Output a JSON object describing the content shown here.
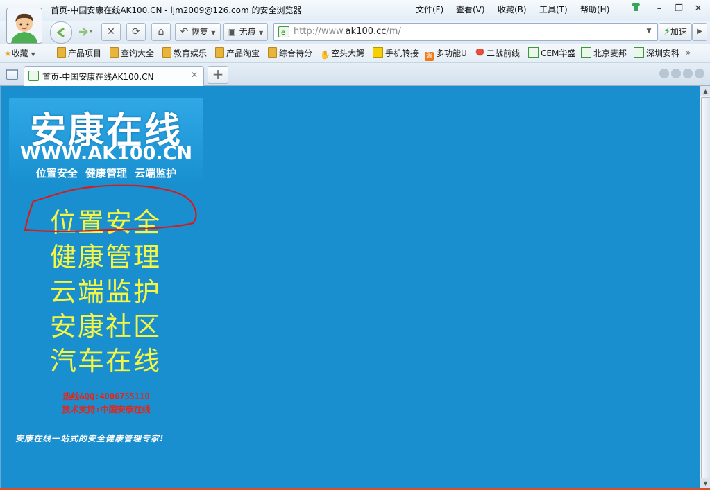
{
  "window": {
    "title": "首页-中国安康在线AK100.CN - ljm2009@126.com 的安全浏览器",
    "menu": [
      {
        "label": "文件(F)"
      },
      {
        "label": "查看(V)"
      },
      {
        "label": "收藏(B)"
      },
      {
        "label": "工具(T)"
      },
      {
        "label": "帮助(H)"
      }
    ],
    "controls": {
      "minimize": "–",
      "restore": "❐",
      "close": "✕"
    }
  },
  "toolbar": {
    "back_icon": "back-arrow-icon",
    "forward_icon": "forward-arrow-icon",
    "stop": "✕",
    "refresh": "⟳",
    "home": "⌂",
    "restore_label": "恢复",
    "incognito_label": "无痕",
    "url_scheme": "http://www.",
    "url_host": "ak100.cc",
    "url_path": "/m/",
    "accelerate_label": "加速"
  },
  "bookmarks": {
    "favorites_label": "收藏",
    "items": [
      {
        "label": "产品项目",
        "icon": "folder-icon"
      },
      {
        "label": "查询大全",
        "icon": "folder-icon"
      },
      {
        "label": "教育娱乐",
        "icon": "folder-icon"
      },
      {
        "label": "产品淘宝",
        "icon": "folder-icon"
      },
      {
        "label": "综合待分",
        "icon": "folder-icon"
      },
      {
        "label": "空头大鳄",
        "icon": "hand-icon"
      },
      {
        "label": "手机转接",
        "icon": "phone-icon"
      },
      {
        "label": "多功能U",
        "icon": "tao-icon"
      },
      {
        "label": "二战前线",
        "icon": "pin-icon"
      },
      {
        "label": "CEM华盛",
        "icon": "ie-page-icon"
      },
      {
        "label": "北京麦邦",
        "icon": "ie-page-icon"
      },
      {
        "label": "深圳安科",
        "icon": "ie-page-icon"
      }
    ],
    "more": "»"
  },
  "tabs": [
    {
      "title": "首页-中国安康在线AK100.CN",
      "close": "✕"
    }
  ],
  "newtab": "+",
  "page": {
    "logo_title": "安康在线",
    "logo_url": "WWW.AK100.CN",
    "logo_tagline": "位置安全 健康管理 云端监护",
    "nav": [
      {
        "label": "位置安全"
      },
      {
        "label": "健康管理"
      },
      {
        "label": "云端监护"
      },
      {
        "label": "安康社区"
      },
      {
        "label": "汽车在线"
      }
    ],
    "hotline": "热线&QQ:4006755110",
    "support": "技术支持:中国安康在线",
    "slogan": "安康在线一站式的安全健康管理专家!",
    "accent_yellow": "#f5f544",
    "background_blue": "#1a8fd0",
    "annotation_color": "#d41c1c"
  }
}
